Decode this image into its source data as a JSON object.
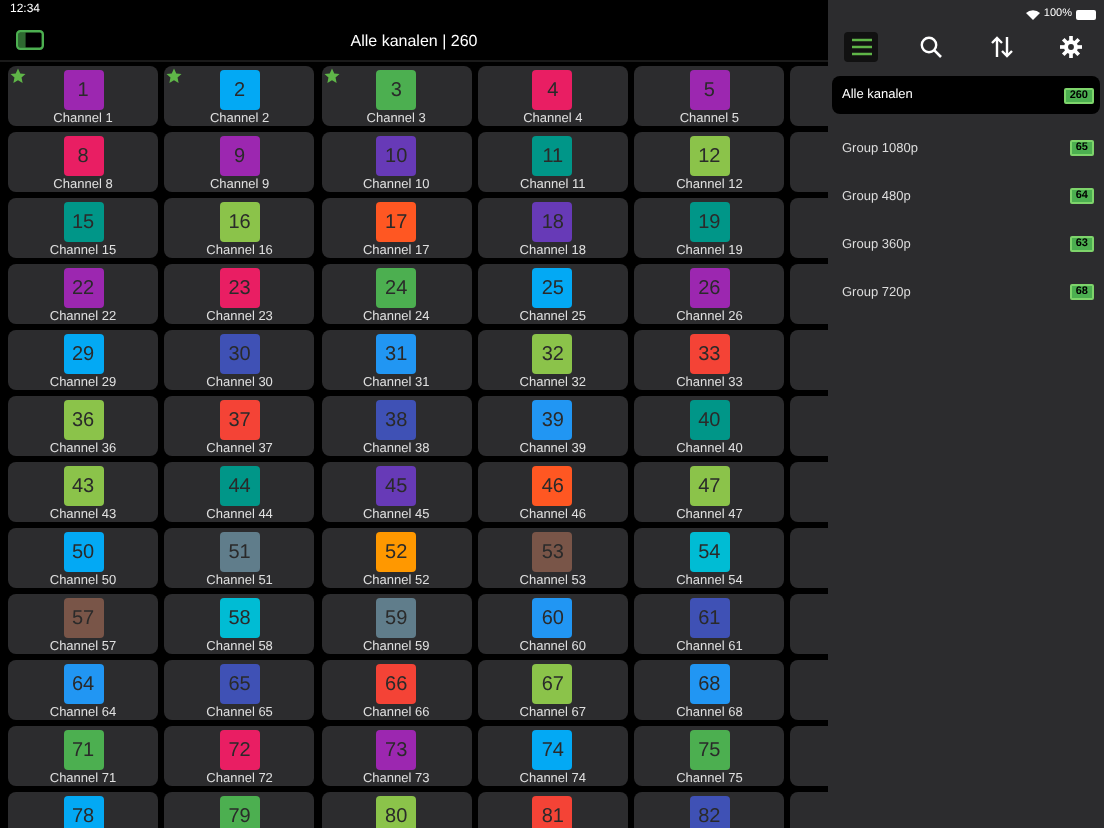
{
  "status_bar": {
    "time": "12:34",
    "battery": "100%"
  },
  "nav": {
    "title": "Alle kanalen | 260"
  },
  "channels": [
    {
      "number": "1",
      "name": "Channel 1",
      "color": "#9c27b0",
      "favorite": true
    },
    {
      "number": "2",
      "name": "Channel 2",
      "color": "#03a9f4",
      "favorite": true
    },
    {
      "number": "3",
      "name": "Channel 3",
      "color": "#4caf50",
      "favorite": true
    },
    {
      "number": "4",
      "name": "Channel 4",
      "color": "#e91e63",
      "favorite": false
    },
    {
      "number": "5",
      "name": "Channel 5",
      "color": "#9c27b0",
      "favorite": false
    },
    {
      "number": "8",
      "name": "Channel 8",
      "color": "#e91e63",
      "favorite": false
    },
    {
      "number": "9",
      "name": "Channel 9",
      "color": "#9c27b0",
      "favorite": false
    },
    {
      "number": "10",
      "name": "Channel 10",
      "color": "#673ab7",
      "favorite": false
    },
    {
      "number": "11",
      "name": "Channel 11",
      "color": "#009688",
      "favorite": false
    },
    {
      "number": "12",
      "name": "Channel 12",
      "color": "#8bc34a",
      "favorite": false
    },
    {
      "number": "15",
      "name": "Channel 15",
      "color": "#009688",
      "favorite": false
    },
    {
      "number": "16",
      "name": "Channel 16",
      "color": "#8bc34a",
      "favorite": false
    },
    {
      "number": "17",
      "name": "Channel 17",
      "color": "#ff5722",
      "favorite": false
    },
    {
      "number": "18",
      "name": "Channel 18",
      "color": "#673ab7",
      "favorite": false
    },
    {
      "number": "19",
      "name": "Channel 19",
      "color": "#009688",
      "favorite": false
    },
    {
      "number": "22",
      "name": "Channel 22",
      "color": "#9c27b0",
      "favorite": false
    },
    {
      "number": "23",
      "name": "Channel 23",
      "color": "#e91e63",
      "favorite": false
    },
    {
      "number": "24",
      "name": "Channel 24",
      "color": "#4caf50",
      "favorite": false
    },
    {
      "number": "25",
      "name": "Channel 25",
      "color": "#03a9f4",
      "favorite": false
    },
    {
      "number": "26",
      "name": "Channel 26",
      "color": "#9c27b0",
      "favorite": false
    },
    {
      "number": "29",
      "name": "Channel 29",
      "color": "#03a9f4",
      "favorite": false
    },
    {
      "number": "30",
      "name": "Channel 30",
      "color": "#3f51b5",
      "favorite": false
    },
    {
      "number": "31",
      "name": "Channel 31",
      "color": "#2196f3",
      "favorite": false
    },
    {
      "number": "32",
      "name": "Channel 32",
      "color": "#8bc34a",
      "favorite": false
    },
    {
      "number": "33",
      "name": "Channel 33",
      "color": "#f44336",
      "favorite": false
    },
    {
      "number": "36",
      "name": "Channel 36",
      "color": "#8bc34a",
      "favorite": false
    },
    {
      "number": "37",
      "name": "Channel 37",
      "color": "#f44336",
      "favorite": false
    },
    {
      "number": "38",
      "name": "Channel 38",
      "color": "#3f51b5",
      "favorite": false
    },
    {
      "number": "39",
      "name": "Channel 39",
      "color": "#2196f3",
      "favorite": false
    },
    {
      "number": "40",
      "name": "Channel 40",
      "color": "#009688",
      "favorite": false
    },
    {
      "number": "43",
      "name": "Channel 43",
      "color": "#8bc34a",
      "favorite": false
    },
    {
      "number": "44",
      "name": "Channel 44",
      "color": "#009688",
      "favorite": false
    },
    {
      "number": "45",
      "name": "Channel 45",
      "color": "#673ab7",
      "favorite": false
    },
    {
      "number": "46",
      "name": "Channel 46",
      "color": "#ff5722",
      "favorite": false
    },
    {
      "number": "47",
      "name": "Channel 47",
      "color": "#8bc34a",
      "favorite": false
    },
    {
      "number": "50",
      "name": "Channel 50",
      "color": "#03a9f4",
      "favorite": false
    },
    {
      "number": "51",
      "name": "Channel 51",
      "color": "#607d8b",
      "favorite": false
    },
    {
      "number": "52",
      "name": "Channel 52",
      "color": "#ff9800",
      "favorite": false
    },
    {
      "number": "53",
      "name": "Channel 53",
      "color": "#795548",
      "favorite": false
    },
    {
      "number": "54",
      "name": "Channel 54",
      "color": "#00bcd4",
      "favorite": false
    },
    {
      "number": "57",
      "name": "Channel 57",
      "color": "#795548",
      "favorite": false
    },
    {
      "number": "58",
      "name": "Channel 58",
      "color": "#00bcd4",
      "favorite": false
    },
    {
      "number": "59",
      "name": "Channel 59",
      "color": "#607d8b",
      "favorite": false
    },
    {
      "number": "60",
      "name": "Channel 60",
      "color": "#2196f3",
      "favorite": false
    },
    {
      "number": "61",
      "name": "Channel 61",
      "color": "#3f51b5",
      "favorite": false
    },
    {
      "number": "64",
      "name": "Channel 64",
      "color": "#2196f3",
      "favorite": false
    },
    {
      "number": "65",
      "name": "Channel 65",
      "color": "#3f51b5",
      "favorite": false
    },
    {
      "number": "66",
      "name": "Channel 66",
      "color": "#f44336",
      "favorite": false
    },
    {
      "number": "67",
      "name": "Channel 67",
      "color": "#8bc34a",
      "favorite": false
    },
    {
      "number": "68",
      "name": "Channel 68",
      "color": "#2196f3",
      "favorite": false
    },
    {
      "number": "71",
      "name": "Channel 71",
      "color": "#4caf50",
      "favorite": false
    },
    {
      "number": "72",
      "name": "Channel 72",
      "color": "#e91e63",
      "favorite": false
    },
    {
      "number": "73",
      "name": "Channel 73",
      "color": "#9c27b0",
      "favorite": false
    },
    {
      "number": "74",
      "name": "Channel 74",
      "color": "#03a9f4",
      "favorite": false
    },
    {
      "number": "75",
      "name": "Channel 75",
      "color": "#4caf50",
      "favorite": false
    },
    {
      "number": "78",
      "color": "#03a9f4",
      "favorite": false
    },
    {
      "number": "79",
      "color": "#4caf50",
      "favorite": false
    },
    {
      "number": "80",
      "color": "#8bc34a",
      "favorite": false
    },
    {
      "number": "81",
      "color": "#f44336",
      "favorite": false
    },
    {
      "number": "82",
      "color": "#3f51b5",
      "favorite": false
    }
  ],
  "sidebar": {
    "toolbar": [
      {
        "kind": "menu",
        "selected": true
      },
      {
        "kind": "search",
        "selected": false
      },
      {
        "kind": "sort",
        "selected": false
      },
      {
        "kind": "settings",
        "selected": false
      }
    ],
    "groups": [
      {
        "label": "Alle kanalen",
        "count": "260",
        "selected": true
      },
      {
        "label": "Group 1080p",
        "count": "65",
        "selected": false
      },
      {
        "label": "Group 480p",
        "count": "64",
        "selected": false
      },
      {
        "label": "Group 360p",
        "count": "63",
        "selected": false
      },
      {
        "label": "Group 720p",
        "count": "68",
        "selected": false
      }
    ]
  }
}
